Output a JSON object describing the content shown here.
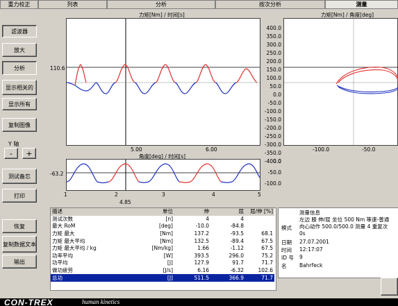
{
  "tabs": [
    "重力校正",
    "列表",
    "分析",
    "按次分析",
    "测量"
  ],
  "sidebar": {
    "buttons": [
      "滤波器",
      "放大",
      "分析",
      "显示相关的",
      "显示所有",
      "复制图像",
      "测试备忘",
      "打印",
      "恢复",
      "复制数据文本",
      "输出"
    ],
    "y_axis_label": "Y 轴",
    "minus": "-",
    "plus": "+"
  },
  "top_chart": {
    "title": "力矩[Nm] / 时间[s]",
    "cursor_value": "110.6",
    "y_ticks": [
      "400.0",
      "350.0",
      "300.0",
      "250.0",
      "200.0",
      "150.0",
      "100.0",
      "50.0",
      "0.0",
      "-50.0",
      "-100.0",
      "-150.0",
      "-200.0",
      "-250.0",
      "-300.0",
      "-350.0",
      "-400.0"
    ],
    "x_ticks": [
      "5.00",
      "6.00"
    ]
  },
  "right_chart": {
    "title": "力矩[Nm] / 角度[deg]",
    "x_ticks": [
      "-100.0",
      "-50.0"
    ]
  },
  "bottom_chart": {
    "title": "角度[deg] / 时间[s]",
    "cursor_value": "-63.2",
    "y_ticks": [
      "0.0",
      "-50.0",
      "-100.0"
    ],
    "markers": [
      "1",
      "2",
      "3",
      "4",
      "5"
    ],
    "cursor_time": "4.85"
  },
  "table": {
    "headers": [
      "描述",
      "单位",
      "伸",
      "屈",
      "屈/伸 [%]"
    ],
    "rows": [
      [
        "测试次数",
        "[n]",
        "4",
        "4",
        ""
      ],
      [
        "最大 RoM",
        "[deg]",
        "-10.0",
        "-84.8",
        ""
      ],
      [
        "力矩 最大",
        "[Nm]",
        "137.2",
        "-93.5",
        "68.1"
      ],
      [
        "力矩 最大平均",
        "[Nm]",
        "132.5",
        "-89.4",
        "67.5"
      ],
      [
        "力矩 最大平均 / kg",
        "[Nm/kg]",
        "1.66",
        "-1.12",
        "67.5"
      ],
      [
        "功率平均",
        "[W]",
        "393.5",
        "296.0",
        "75.2"
      ],
      [
        "功平均",
        "[J]",
        "127.9",
        "91.7",
        "71.7"
      ],
      [
        "做功疲劳",
        "[J/s]",
        "6.16",
        "-6.32",
        "102.6"
      ],
      [
        "总功",
        "[J]",
        "511.5",
        "366.9",
        "71.7"
      ]
    ],
    "selected_row": 8
  },
  "info": {
    "header": "测量信息",
    "mode_label": "模式",
    "mode_value_1": "左边 膝 伸/屈 坐位 500 Nm 等速-普通",
    "mode_value_2": "向心动作 500.0/500.0 测量 4 重复次",
    "mode_value_3": "0s",
    "date_label": "日期",
    "date_value": "27.07.2001",
    "time_label": "时间",
    "time_value": "12:17:07",
    "id_label": "ID 号",
    "id_value": "9",
    "name_label": "名",
    "name_value": "Bahrfeck"
  },
  "brand": {
    "logo": "CON-TREX",
    "tagline": "human kinetics"
  },
  "colors": {
    "extension": "#e03030",
    "flexion": "#2030c0",
    "selection": "#0a24a0"
  }
}
